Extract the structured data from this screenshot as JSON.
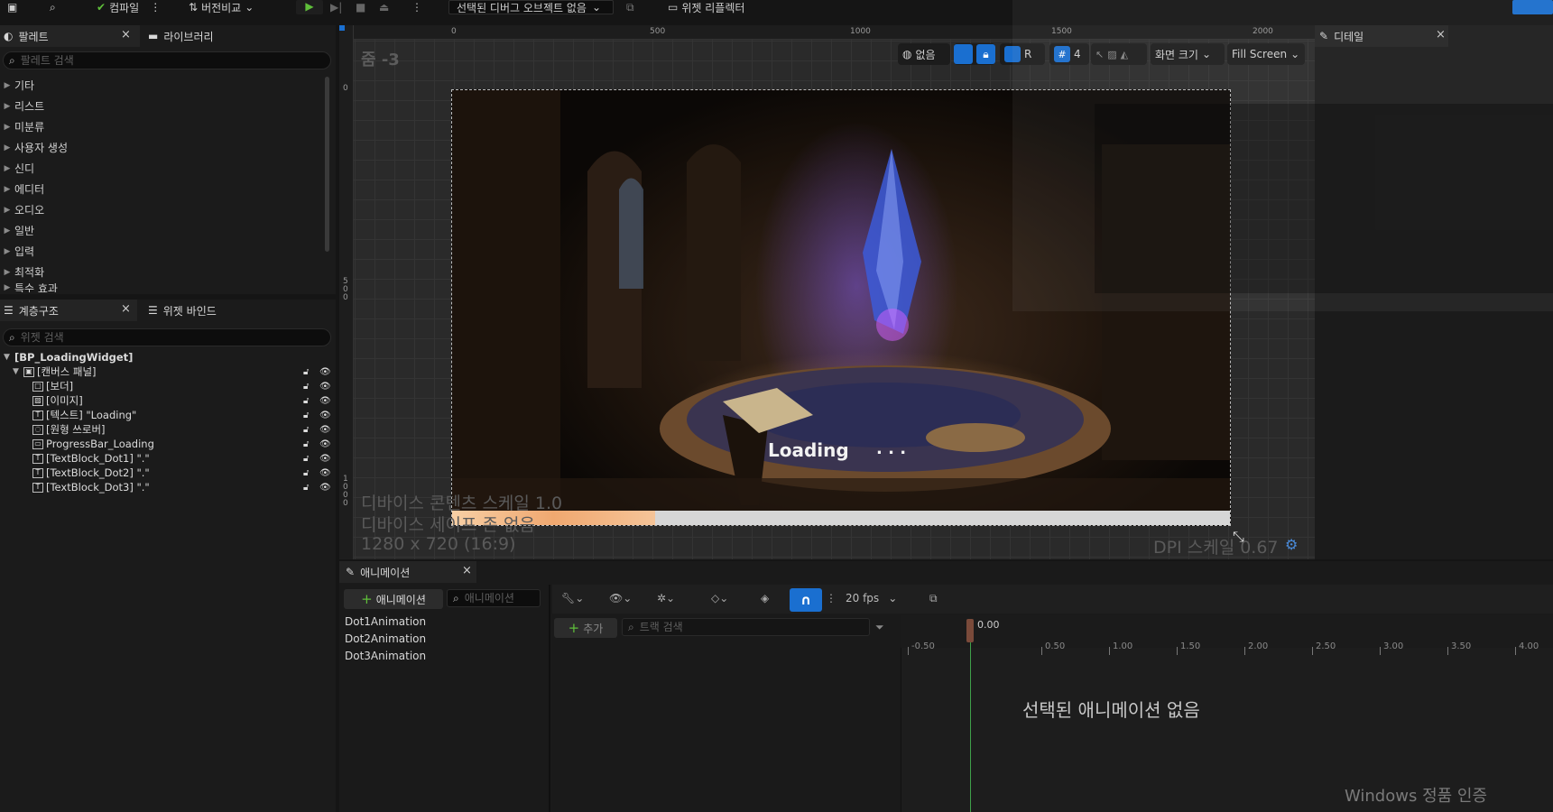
{
  "toolbar": {
    "compile_label": "컴파일",
    "diff_label": "버전비교",
    "debug_select": "선택된 디버그 오브젝트 없음",
    "reflector_label": "위젯 리플렉터"
  },
  "palette": {
    "tab_label": "팔레트",
    "library_tab_label": "라이브러리",
    "search_placeholder": "팔레트 검색",
    "categories": [
      "기타",
      "리스트",
      "미분류",
      "사용자 생성",
      "신디",
      "에디터",
      "오디오",
      "일반",
      "입력",
      "최적화",
      "특수 효과"
    ]
  },
  "hierarchy": {
    "tab_label": "계층구조",
    "bind_tab_label": "위젯 바인드",
    "search_placeholder": "위젯 검색",
    "items": [
      {
        "label": "[BP_LoadingWidget]",
        "icon": "none"
      },
      {
        "label": "[캔버스 패널]",
        "icon": "canvas-panel-icon"
      },
      {
        "label": "[보더]",
        "icon": "border-icon"
      },
      {
        "label": "[이미지]",
        "icon": "image-icon"
      },
      {
        "label": "[텍스트] \"Loading\"",
        "icon": "text-icon"
      },
      {
        "label": "[원형 쓰로버]",
        "icon": "throbber-icon"
      },
      {
        "label": "ProgressBar_Loading",
        "icon": "progressbar-icon"
      },
      {
        "label": "[TextBlock_Dot1] \".\"",
        "icon": "text-icon"
      },
      {
        "label": "[TextBlock_Dot2] \".\"",
        "icon": "text-icon"
      },
      {
        "label": "[TextBlock_Dot3] \".\"",
        "icon": "text-icon"
      }
    ]
  },
  "viewport": {
    "zoom_label": "줌 -3",
    "ruler_top": [
      "0",
      "500",
      "1000",
      "1500",
      "2000"
    ],
    "ruler_left": [
      "0",
      "500",
      "1000"
    ],
    "none_label": "없음",
    "r_label": "R",
    "grid_count": "4",
    "screen_size_label": "화면 크기",
    "fill_screen_label": "Fill Screen",
    "loading_text": "Loading",
    "dots": ". . .",
    "progress": 0.26,
    "device_content_scale": "디바이스 콘텐츠 스케일 1.0",
    "device_safe_zone": "디바이스 세이프 존 없음",
    "resolution": "1280 x 720 (16:9)",
    "dpi_scale": "DPI 스케일 0.67"
  },
  "details": {
    "tab_label": "디테일"
  },
  "animation": {
    "tab_label": "애니메이션",
    "add_label": "애니메이션",
    "search_placeholder": "애니메이션",
    "items": [
      "Dot1Animation",
      "Dot2Animation",
      "Dot3Animation"
    ],
    "fps_label": "20 fps",
    "track_add_label": "추가",
    "track_search_placeholder": "트랙 검색",
    "time_current": "0.00",
    "ticks": [
      "-0.50",
      "0.50",
      "1.00",
      "1.50",
      "2.00",
      "2.50",
      "3.00",
      "3.50",
      "4.00"
    ],
    "empty_message": "선택된 애니메이션 없음"
  },
  "watermark": "Windows 정품 인증",
  "colors": {
    "accent_blue": "#1a6fd0",
    "progress_fill": "#f0a870",
    "progress_bg": "#d6d6d6"
  }
}
